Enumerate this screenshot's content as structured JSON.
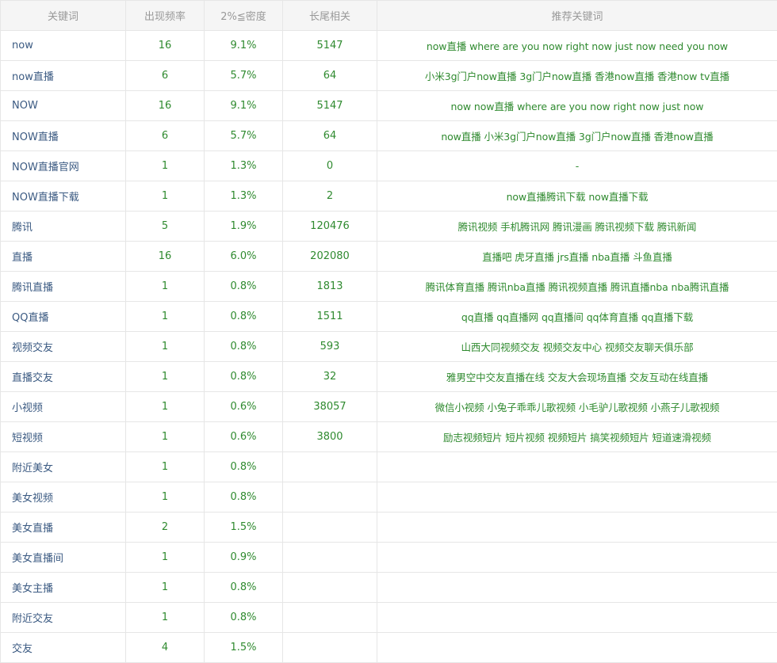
{
  "headers": {
    "keyword": "关键词",
    "frequency": "出现频率",
    "density": "2%≦密度",
    "longtail": "长尾相关",
    "recommend": "推荐关键词"
  },
  "rows": [
    {
      "keyword": "now",
      "frequency": "16",
      "density": "9.1%",
      "longtail": "5147",
      "recommend": "now直播 where are you now right now just now need you now"
    },
    {
      "keyword": "now直播",
      "frequency": "6",
      "density": "5.7%",
      "longtail": "64",
      "recommend": "小米3g门户now直播 3g门户now直播 香港now直播 香港now tv直播"
    },
    {
      "keyword": "NOW",
      "frequency": "16",
      "density": "9.1%",
      "longtail": "5147",
      "recommend": "now now直播 where are you now right now just now"
    },
    {
      "keyword": "NOW直播",
      "frequency": "6",
      "density": "5.7%",
      "longtail": "64",
      "recommend": "now直播 小米3g门户now直播 3g门户now直播 香港now直播"
    },
    {
      "keyword": "NOW直播官网",
      "frequency": "1",
      "density": "1.3%",
      "longtail": "0",
      "recommend": "-"
    },
    {
      "keyword": "NOW直播下载",
      "frequency": "1",
      "density": "1.3%",
      "longtail": "2",
      "recommend": "now直播腾讯下载 now直播下载"
    },
    {
      "keyword": "腾讯",
      "frequency": "5",
      "density": "1.9%",
      "longtail": "120476",
      "recommend": "腾讯视频 手机腾讯网 腾讯漫画 腾讯视频下载 腾讯新闻"
    },
    {
      "keyword": "直播",
      "frequency": "16",
      "density": "6.0%",
      "longtail": "202080",
      "recommend": "直播吧 虎牙直播 jrs直播 nba直播 斗鱼直播"
    },
    {
      "keyword": "腾讯直播",
      "frequency": "1",
      "density": "0.8%",
      "longtail": "1813",
      "recommend": "腾讯体育直播 腾讯nba直播 腾讯视频直播 腾讯直播nba nba腾讯直播"
    },
    {
      "keyword": "QQ直播",
      "frequency": "1",
      "density": "0.8%",
      "longtail": "1511",
      "recommend": "qq直播 qq直播网 qq直播间 qq体育直播 qq直播下载"
    },
    {
      "keyword": "视频交友",
      "frequency": "1",
      "density": "0.8%",
      "longtail": "593",
      "recommend": "山西大同视频交友 视频交友中心 视频交友聊天俱乐部"
    },
    {
      "keyword": "直播交友",
      "frequency": "1",
      "density": "0.8%",
      "longtail": "32",
      "recommend": "雅男空中交友直播在线 交友大会现场直播 交友互动在线直播"
    },
    {
      "keyword": "小视频",
      "frequency": "1",
      "density": "0.6%",
      "longtail": "38057",
      "recommend": "微信小视频 小兔子乖乖儿歌视频 小毛驴儿歌视频 小燕子儿歌视频"
    },
    {
      "keyword": "短视频",
      "frequency": "1",
      "density": "0.6%",
      "longtail": "3800",
      "recommend": "励志视频短片 短片视频 视频短片 搞笑视频短片 短道速滑视频"
    },
    {
      "keyword": "附近美女",
      "frequency": "1",
      "density": "0.8%",
      "longtail": "",
      "recommend": ""
    },
    {
      "keyword": "美女视频",
      "frequency": "1",
      "density": "0.8%",
      "longtail": "",
      "recommend": ""
    },
    {
      "keyword": "美女直播",
      "frequency": "2",
      "density": "1.5%",
      "longtail": "",
      "recommend": ""
    },
    {
      "keyword": "美女直播间",
      "frequency": "1",
      "density": "0.9%",
      "longtail": "",
      "recommend": ""
    },
    {
      "keyword": "美女主播",
      "frequency": "1",
      "density": "0.8%",
      "longtail": "",
      "recommend": ""
    },
    {
      "keyword": "附近交友",
      "frequency": "1",
      "density": "0.8%",
      "longtail": "",
      "recommend": ""
    },
    {
      "keyword": "交友",
      "frequency": "4",
      "density": "1.5%",
      "longtail": "",
      "recommend": ""
    }
  ]
}
